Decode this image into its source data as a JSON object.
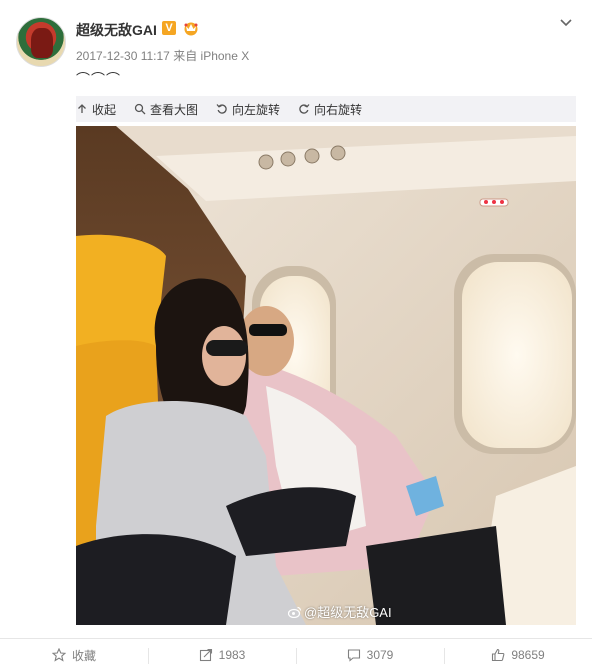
{
  "post": {
    "username": "超级无敌GAI",
    "verified_badge": "V",
    "timestamp": "2017-12-30 11:17",
    "source": "来自 iPhone X",
    "text": "⌒⌒⌒"
  },
  "image_toolbar": {
    "collapse": "收起",
    "view_large": "查看大图",
    "rotate_left": "向左旋转",
    "rotate_right": "向右旋转"
  },
  "watermark": "@超级无敌GAI",
  "actions": {
    "favorite": "收藏",
    "repost_count": "1983",
    "comment_count": "3079",
    "like_count": "98659"
  },
  "icons": {
    "more": "chevron-down-icon",
    "collapse": "arrow-up-icon",
    "view_large": "magnifier-icon",
    "rotate_left": "rotate-left-icon",
    "rotate_right": "rotate-right-icon",
    "favorite": "star-icon",
    "repost": "share-arrow-icon",
    "comment": "comment-icon",
    "like": "thumbs-up-icon"
  },
  "colors": {
    "accent": "#f5a623",
    "meta_text": "#808080",
    "toolbar_bg": "#f2f2f5"
  }
}
